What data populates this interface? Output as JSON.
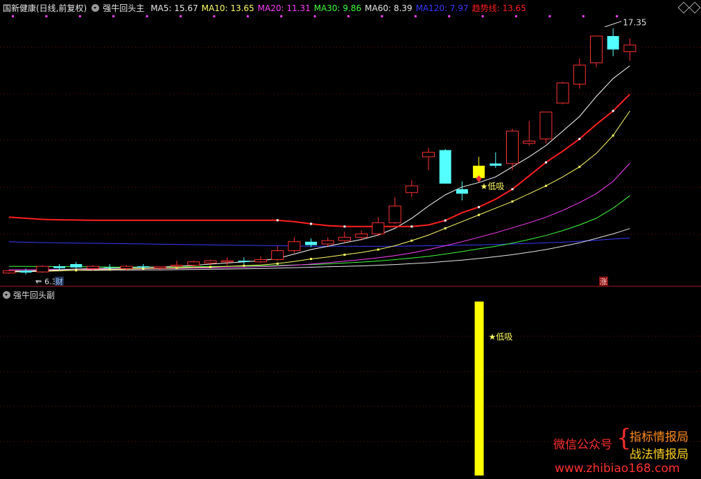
{
  "header": {
    "stock_title": "国新健康(日线,前复权)",
    "indicator_name": "强牛回头主",
    "ma_items": [
      {
        "label": "MA5: 15.67",
        "color": "#e8e8e8"
      },
      {
        "label": "MA10: 13.65",
        "color": "#ffff66"
      },
      {
        "label": "MA20: 11.31",
        "color": "#ff40ff"
      },
      {
        "label": "MA30: 9.86",
        "color": "#40ff40"
      },
      {
        "label": "MA60: 8.39",
        "color": "#e8e8e8"
      },
      {
        "label": "MA120: 7.97",
        "color": "#3a3aff"
      },
      {
        "label": "趋势线: 13.65",
        "color": "#ff2020"
      }
    ]
  },
  "sub_panel": {
    "title": "强牛回头副",
    "signal_label": "★低吸",
    "bar_color": "#ffff00"
  },
  "annotations": {
    "high_price": "17.35",
    "low_price": "6.34",
    "signal_label": "★低吸",
    "cai_badge": "财",
    "zhang_badge": "涨"
  },
  "watermark": {
    "left_label": "微信公众号",
    "brace": "{",
    "line1": "指标情报局",
    "line2": "战法情报局",
    "url": "www.zhibiao168.com"
  },
  "colors": {
    "up": "#ff3232",
    "down": "#54ffff",
    "trend": "#ff2020",
    "grid": "#7a1010",
    "signal": "#ffff00"
  },
  "chart_data": {
    "type": "candlestick",
    "y_range": [
      5.9,
      17.9
    ],
    "candles": [
      {
        "o": 6.4,
        "h": 6.55,
        "l": 6.36,
        "c": 6.5
      },
      {
        "o": 6.5,
        "h": 6.6,
        "l": 6.34,
        "c": 6.42
      },
      {
        "o": 6.45,
        "h": 6.75,
        "l": 6.42,
        "c": 6.7
      },
      {
        "o": 6.7,
        "h": 6.8,
        "l": 6.55,
        "c": 6.62
      },
      {
        "o": 6.8,
        "h": 6.9,
        "l": 6.6,
        "c": 6.65
      },
      {
        "o": 6.6,
        "h": 6.75,
        "l": 6.5,
        "c": 6.7
      },
      {
        "o": 6.65,
        "h": 6.8,
        "l": 6.55,
        "c": 6.62
      },
      {
        "o": 6.6,
        "h": 6.75,
        "l": 6.52,
        "c": 6.7
      },
      {
        "o": 6.7,
        "h": 6.8,
        "l": 6.6,
        "c": 6.65
      },
      {
        "o": 6.62,
        "h": 6.7,
        "l": 6.55,
        "c": 6.68
      },
      {
        "o": 6.7,
        "h": 6.95,
        "l": 6.62,
        "c": 6.75
      },
      {
        "o": 6.75,
        "h": 6.95,
        "l": 6.65,
        "c": 6.9
      },
      {
        "o": 6.85,
        "h": 7.0,
        "l": 6.75,
        "c": 6.95
      },
      {
        "o": 6.9,
        "h": 7.1,
        "l": 6.75,
        "c": 6.95
      },
      {
        "o": 6.95,
        "h": 7.1,
        "l": 6.8,
        "c": 6.9
      },
      {
        "o": 6.9,
        "h": 7.15,
        "l": 6.85,
        "c": 7.0
      },
      {
        "o": 7.0,
        "h": 7.6,
        "l": 6.95,
        "c": 7.4
      },
      {
        "o": 7.4,
        "h": 8.0,
        "l": 7.3,
        "c": 7.8
      },
      {
        "o": 7.8,
        "h": 7.95,
        "l": 7.55,
        "c": 7.65
      },
      {
        "o": 7.7,
        "h": 8.0,
        "l": 7.6,
        "c": 7.85
      },
      {
        "o": 7.85,
        "h": 8.25,
        "l": 7.75,
        "c": 8.0
      },
      {
        "o": 8.0,
        "h": 8.3,
        "l": 7.85,
        "c": 8.15
      },
      {
        "o": 8.15,
        "h": 8.9,
        "l": 8.05,
        "c": 8.65
      },
      {
        "o": 8.65,
        "h": 9.8,
        "l": 8.6,
        "c": 9.4
      },
      {
        "o": 10.0,
        "h": 10.55,
        "l": 9.8,
        "c": 10.3
      },
      {
        "o": 11.6,
        "h": 12.0,
        "l": 11.0,
        "c": 11.8
      },
      {
        "o": 11.9,
        "h": 11.95,
        "l": 10.4,
        "c": 10.4
      },
      {
        "o": 10.15,
        "h": 10.5,
        "l": 9.65,
        "c": 9.95
      },
      {
        "o": 11.2,
        "h": 11.6,
        "l": 10.65,
        "c": 10.65
      },
      {
        "o": 11.3,
        "h": 11.8,
        "l": 11.1,
        "c": 11.2
      },
      {
        "o": 11.3,
        "h": 12.85,
        "l": 11.0,
        "c": 12.75
      },
      {
        "o": 12.2,
        "h": 13.2,
        "l": 12.1,
        "c": 12.3
      },
      {
        "o": 12.4,
        "h": 13.6,
        "l": 12.2,
        "c": 13.6
      },
      {
        "o": 14.0,
        "h": 14.95,
        "l": 13.95,
        "c": 14.9
      },
      {
        "o": 14.85,
        "h": 16.0,
        "l": 14.65,
        "c": 15.7
      },
      {
        "o": 15.8,
        "h": 17.0,
        "l": 15.6,
        "c": 17.0
      },
      {
        "o": 17.0,
        "h": 17.35,
        "l": 16.1,
        "c": 16.4
      },
      {
        "o": 16.3,
        "h": 16.9,
        "l": 15.9,
        "c": 16.6
      }
    ],
    "ma5": [
      6.47,
      6.47,
      6.5,
      6.55,
      6.58,
      6.6,
      6.62,
      6.63,
      6.65,
      6.67,
      6.7,
      6.74,
      6.8,
      6.85,
      6.9,
      6.95,
      7.05,
      7.25,
      7.45,
      7.6,
      7.75,
      7.9,
      8.1,
      8.4,
      8.85,
      9.4,
      9.9,
      10.25,
      10.45,
      10.7,
      11.15,
      11.6,
      12.1,
      12.75,
      13.4,
      14.3,
      15.1,
      15.67
    ],
    "ma10": [
      6.45,
      6.46,
      6.48,
      6.5,
      6.52,
      6.54,
      6.56,
      6.58,
      6.6,
      6.61,
      6.63,
      6.65,
      6.67,
      6.7,
      6.73,
      6.76,
      6.82,
      6.92,
      7.03,
      7.12,
      7.22,
      7.32,
      7.45,
      7.62,
      7.85,
      8.1,
      8.4,
      8.7,
      9.0,
      9.3,
      9.6,
      9.95,
      10.3,
      10.7,
      11.15,
      11.75,
      12.55,
      13.65
    ],
    "ma20": [
      6.55,
      6.55,
      6.56,
      6.56,
      6.57,
      6.57,
      6.58,
      6.58,
      6.59,
      6.6,
      6.61,
      6.62,
      6.63,
      6.64,
      6.66,
      6.68,
      6.71,
      6.75,
      6.8,
      6.86,
      6.93,
      7.0,
      7.08,
      7.18,
      7.3,
      7.45,
      7.62,
      7.8,
      8.0,
      8.2,
      8.42,
      8.65,
      8.9,
      9.2,
      9.55,
      9.95,
      10.5,
      11.31
    ],
    "ma30": [
      6.7,
      6.7,
      6.69,
      6.69,
      6.68,
      6.68,
      6.67,
      6.67,
      6.67,
      6.67,
      6.67,
      6.68,
      6.69,
      6.7,
      6.71,
      6.72,
      6.74,
      6.76,
      6.78,
      6.81,
      6.85,
      6.89,
      6.94,
      7.0,
      7.07,
      7.15,
      7.25,
      7.36,
      7.48,
      7.6,
      7.74,
      7.9,
      8.08,
      8.3,
      8.55,
      8.85,
      9.3,
      9.86
    ],
    "ma60": [
      6.5,
      6.5,
      6.51,
      6.51,
      6.52,
      6.52,
      6.53,
      6.53,
      6.54,
      6.54,
      6.55,
      6.56,
      6.57,
      6.58,
      6.59,
      6.6,
      6.62,
      6.64,
      6.66,
      6.68,
      6.7,
      6.72,
      6.75,
      6.78,
      6.82,
      6.86,
      6.92,
      6.98,
      7.05,
      7.13,
      7.22,
      7.33,
      7.45,
      7.6,
      7.75,
      7.95,
      8.15,
      8.39
    ],
    "ma120": [
      7.8,
      7.78,
      7.76,
      7.75,
      7.74,
      7.73,
      7.72,
      7.71,
      7.7,
      7.69,
      7.68,
      7.67,
      7.66,
      7.65,
      7.64,
      7.63,
      7.62,
      7.61,
      7.6,
      7.6,
      7.6,
      7.6,
      7.6,
      7.6,
      7.61,
      7.62,
      7.63,
      7.65,
      7.66,
      7.68,
      7.7,
      7.72,
      7.75,
      7.78,
      7.82,
      7.87,
      7.92,
      7.97
    ],
    "trend": [
      8.9,
      8.85,
      8.8,
      8.78,
      8.77,
      8.76,
      8.76,
      8.76,
      8.76,
      8.76,
      8.76,
      8.76,
      8.76,
      8.76,
      8.76,
      8.76,
      8.76,
      8.7,
      8.6,
      8.52,
      8.48,
      8.48,
      8.48,
      8.48,
      8.48,
      8.55,
      8.75,
      9.1,
      9.35,
      9.7,
      10.15,
      10.75,
      11.35,
      11.85,
      12.4,
      13.05,
      13.65,
      14.4
    ],
    "signal_index": 28
  }
}
